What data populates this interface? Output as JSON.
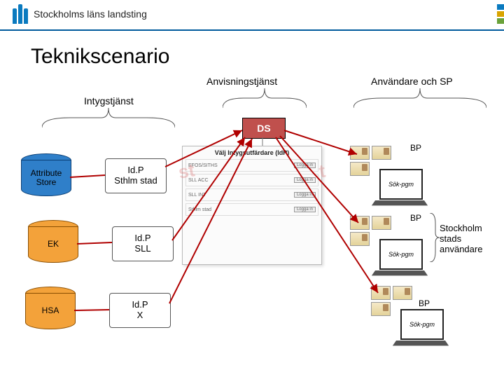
{
  "header": {
    "org_name": "Stockholms läns landsting"
  },
  "title": "Teknikscenario",
  "labels": {
    "anvisning": "Anvisningstjänst",
    "anvandare": "Användare och SP",
    "intyg": "Intygstjänst",
    "stockholm_users": "Stockholm\nstads\nanvändare"
  },
  "nodes": {
    "ds": "DS",
    "attribute_store": "Attribute\nStore",
    "ek": "EK",
    "hsa": "HSA",
    "idp_sthlm": "Id.P\nSthlm stad",
    "idp_sll": "Id.P\nSLL",
    "idp_x": "Id.P\nX"
  },
  "screenshot": {
    "title": "Välj Intygsutfärdare (IdP)",
    "rows": [
      "EFOS/SITHS",
      "SLL ACC",
      "SLL INT",
      "Sthlm stad"
    ],
    "button": "Logga in",
    "watermark_left": "st",
    "watermark_right": "t"
  },
  "client": {
    "bp": "BP",
    "screen_text": "Sök-pgm"
  },
  "colors": {
    "brand_blue": "#0a7abf",
    "edge": [
      "#0a7abf",
      "#d9a400",
      "#6aa23a",
      "#7a3c8f"
    ]
  }
}
